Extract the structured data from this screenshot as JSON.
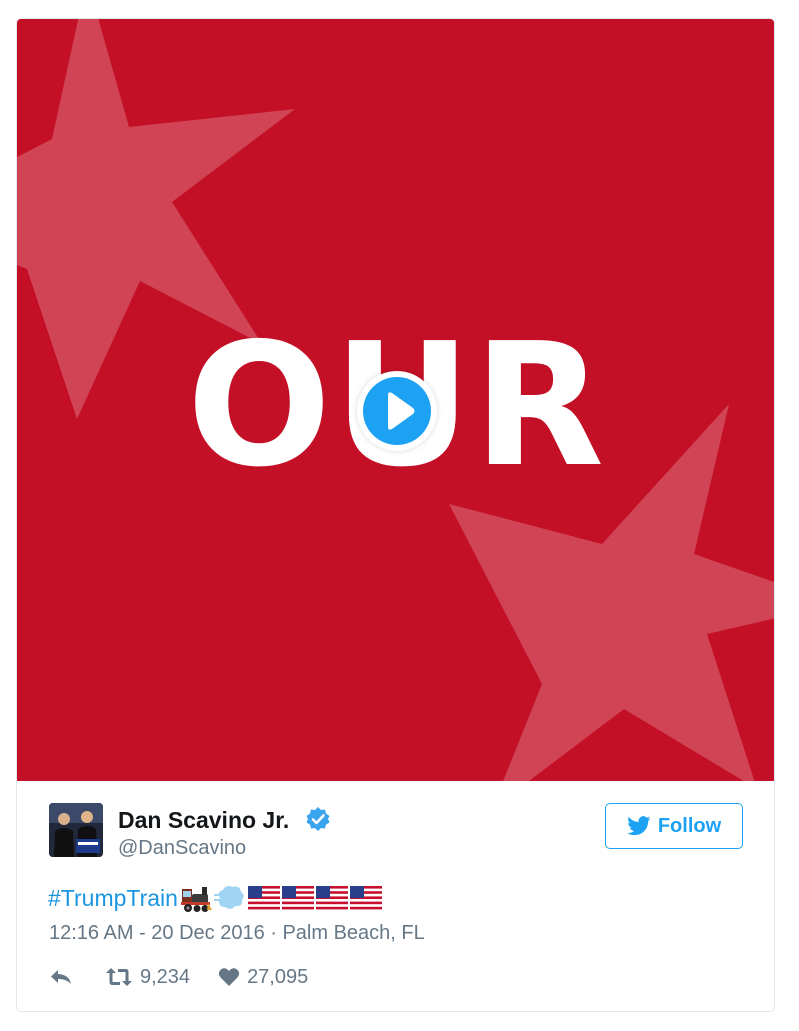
{
  "media": {
    "word": "OUR",
    "background_color": "#c41026",
    "play_icon": "play-icon"
  },
  "author": {
    "name": "Dan Scavino Jr.",
    "handle": "@DanScavino",
    "verified_icon": "verified-badge-icon"
  },
  "follow": {
    "label": "Follow",
    "icon": "twitter-bird-icon",
    "color": "#1da1f2"
  },
  "tweet": {
    "hashtag": "#TrumpTrain",
    "emojis": [
      "locomotive-emoji",
      "dash-emoji",
      "us-flag-emoji",
      "us-flag-emoji",
      "us-flag-emoji",
      "us-flag-emoji"
    ]
  },
  "timestamp": "12:16 AM - 20 Dec 2016 · Palm Beach, FL",
  "actions": {
    "reply_icon": "reply-icon",
    "retweet_icon": "retweet-icon",
    "retweet_count": "9,234",
    "like_icon": "heart-icon",
    "like_count": "27,095"
  }
}
